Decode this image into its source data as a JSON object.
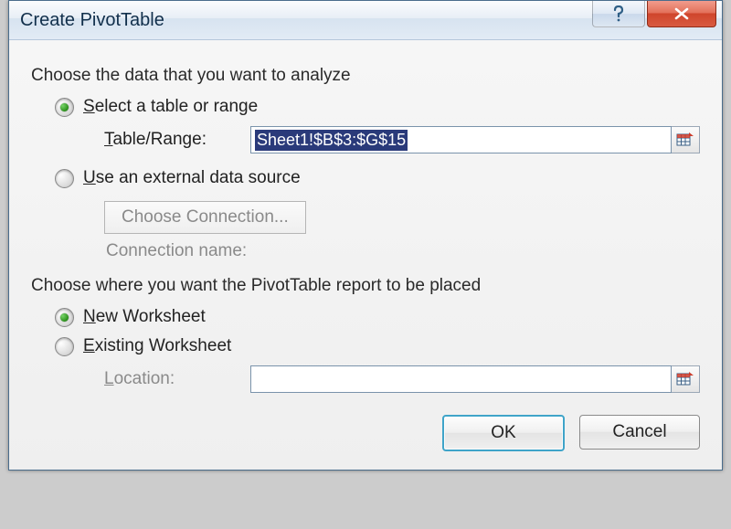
{
  "title": "Create PivotTable",
  "section1_label": "Choose the data that you want to analyze",
  "opt_select_table": {
    "prefix": "S",
    "rest": "elect a table or range",
    "checked": true
  },
  "table_range": {
    "label_prefix": "T",
    "label_rest": "able/Range:",
    "value": "Sheet1!$B$3:$G$15"
  },
  "opt_external": {
    "prefix": "U",
    "rest": "se an external data source",
    "checked": false
  },
  "choose_connection_label": "Choose Connection...",
  "connection_name_label": "Connection name:",
  "section2_label": "Choose where you want the PivotTable report to be placed",
  "opt_new_ws": {
    "prefix": "N",
    "rest": "ew Worksheet",
    "checked": true
  },
  "opt_existing_ws": {
    "prefix": "E",
    "rest": "xisting Worksheet",
    "checked": false
  },
  "location": {
    "label_prefix": "L",
    "label_rest": "ocation:",
    "value": ""
  },
  "buttons": {
    "ok": "OK",
    "cancel": "Cancel"
  }
}
